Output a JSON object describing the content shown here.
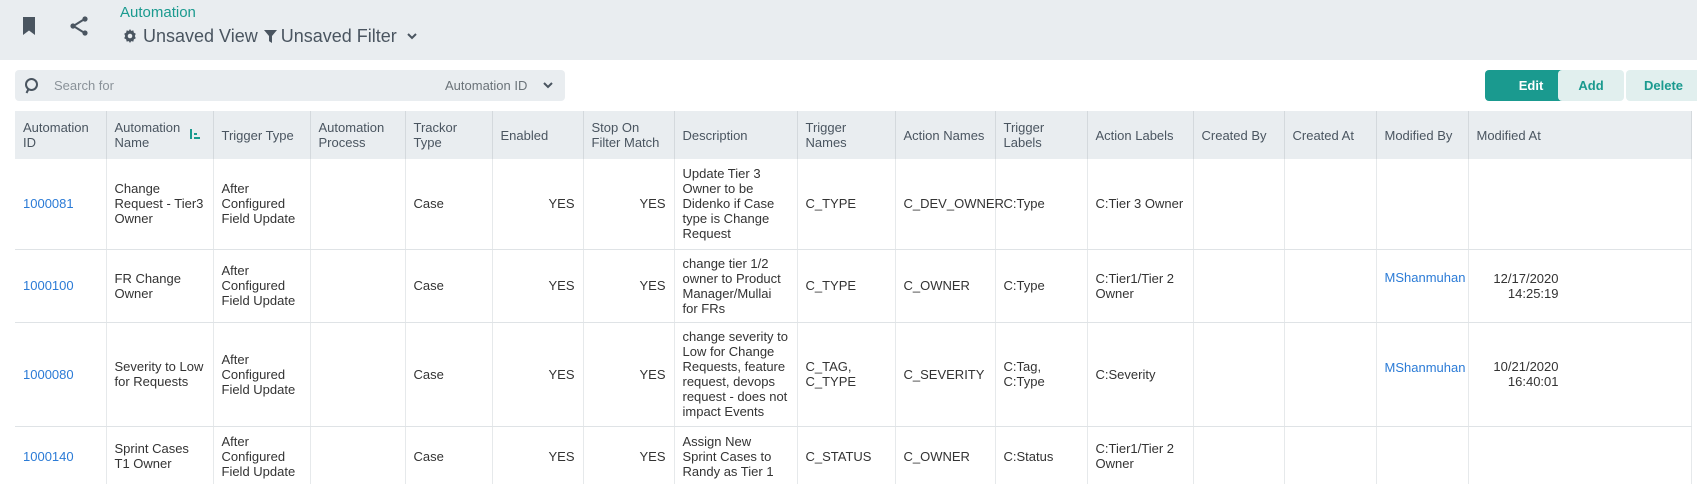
{
  "header": {
    "breadcrumb": "Automation",
    "view_label": "Unsaved View",
    "filter_label": "Unsaved Filter",
    "icons": {
      "bookmark": "bookmark-icon",
      "share": "share-icon",
      "view": "gear-icon",
      "filter": "funnel-icon",
      "menu": "chevron-down-icon"
    }
  },
  "search": {
    "placeholder": "Search for",
    "field": "Automation ID"
  },
  "toolbar": {
    "edit_label": "Edit",
    "add_label": "Add",
    "delete_label": "Delete"
  },
  "colors": {
    "accent": "#1a9a8f",
    "link": "#2b7bd6",
    "header_bg": "#e9edf0"
  },
  "table": {
    "columns": [
      "Automation ID",
      "Automation Name",
      "Trigger Type",
      "Automation Process",
      "Trackor Type",
      "Enabled",
      "Stop On Filter Match",
      "Description",
      "Trigger Names",
      "Action Names",
      "Trigger Labels",
      "Action Labels",
      "Created By",
      "Created At",
      "Modified By",
      "Modified At"
    ],
    "sorted_column": "Automation Name",
    "rows": [
      {
        "id": "1000081",
        "name": "Change Request - Tier3 Owner",
        "trigger_type": "After Configured Field Update",
        "process": "",
        "trackor_type": "Case",
        "enabled": "YES",
        "stop": "YES",
        "description": "Update Tier 3 Owner to be Didenko if Case type is Change Request",
        "trigger_names": "C_TYPE",
        "action_names": "C_DEV_OWNER",
        "trigger_labels": "C:Type",
        "action_labels": "C:Tier 3 Owner",
        "created_by": "",
        "created_at": "",
        "modified_by": "",
        "modified_at": ""
      },
      {
        "id": "1000100",
        "name": "FR Change Owner",
        "trigger_type": "After Configured Field Update",
        "process": "",
        "trackor_type": "Case",
        "enabled": "YES",
        "stop": "YES",
        "description": "change tier 1/2 owner to Product Manager/Mullai for FRs",
        "trigger_names": "C_TYPE",
        "action_names": "C_OWNER",
        "trigger_labels": "C:Type",
        "action_labels": "C:Tier1/Tier 2 Owner",
        "created_by": "",
        "created_at": "",
        "modified_by": "MShanmuhan",
        "modified_at": "12/17/2020 14:25:19"
      },
      {
        "id": "1000080",
        "name": "Severity to Low for Requests",
        "trigger_type": "After Configured Field Update",
        "process": "",
        "trackor_type": "Case",
        "enabled": "YES",
        "stop": "YES",
        "description": "change severity to Low for Change Requests, feature request, devops request - does not impact Events",
        "trigger_names": "C_TAG, C_TYPE",
        "action_names": "C_SEVERITY",
        "trigger_labels": "C:Tag, C:Type",
        "action_labels": "C:Severity",
        "created_by": "",
        "created_at": "",
        "modified_by": "MShanmuhan",
        "modified_at": "10/21/2020 16:40:01"
      },
      {
        "id": "1000140",
        "name": "Sprint Cases T1 Owner",
        "trigger_type": "After Configured Field Update",
        "process": "",
        "trackor_type": "Case",
        "enabled": "YES",
        "stop": "YES",
        "description": "Assign New Sprint Cases to Randy as Tier 1",
        "trigger_names": "C_STATUS",
        "action_names": "C_OWNER",
        "trigger_labels": "C:Status",
        "action_labels": "C:Tier1/Tier 2 Owner",
        "created_by": "",
        "created_at": "",
        "modified_by": "",
        "modified_at": ""
      }
    ]
  }
}
